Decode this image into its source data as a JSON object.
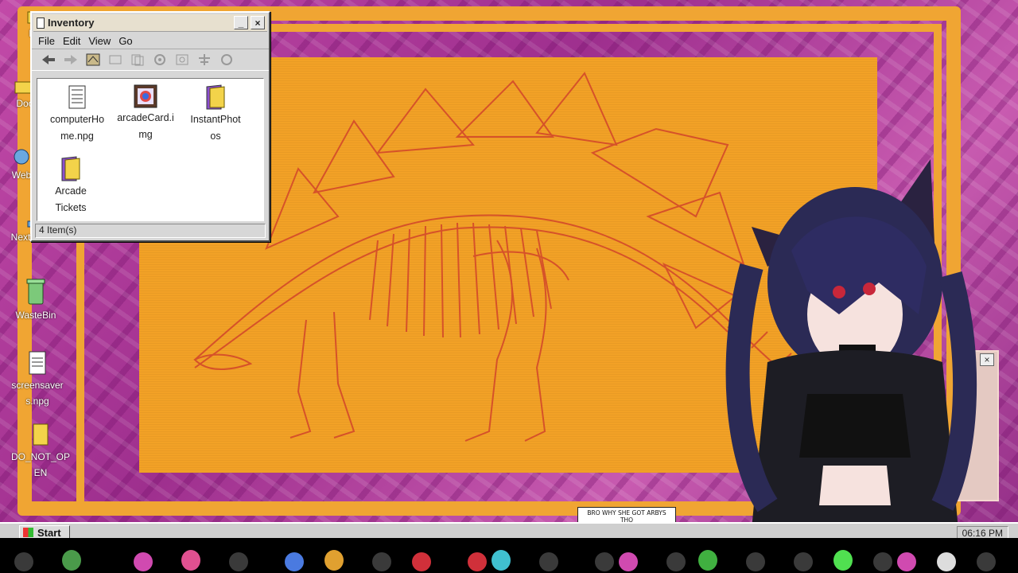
{
  "desktop": {
    "icons": [
      {
        "name": "desktop-icon-docs-1",
        "label": "Doc",
        "type": "folder"
      },
      {
        "name": "desktop-icon-docs-2",
        "label": "Doc",
        "type": "folder"
      },
      {
        "name": "desktop-icon-web",
        "label": "Web",
        "type": "globe"
      },
      {
        "name": "desktop-icon-nexthooms",
        "label": "NextHooms",
        "type": "globe"
      },
      {
        "name": "desktop-icon-wastebin",
        "label": "WasteBin",
        "type": "bin"
      },
      {
        "name": "desktop-icon-screensavers",
        "label": "screensavers.npg",
        "type": "note"
      },
      {
        "name": "desktop-icon-do-not-open",
        "label": "DO_NOT_OPEN",
        "type": "folder"
      }
    ]
  },
  "inventory_window": {
    "title": "Inventory",
    "menu": [
      "File",
      "Edit",
      "View",
      "Go"
    ],
    "files": [
      {
        "label": "computerHome.npg",
        "type": "note"
      },
      {
        "label": "arcadeCard.img",
        "type": "image"
      },
      {
        "label": "InstantPhotos",
        "type": "folder"
      },
      {
        "label": "Arcade Tickets",
        "type": "folder"
      }
    ],
    "status": "4 Item(s)",
    "minimize_label": "_",
    "close_label": "×"
  },
  "secondary_window": {
    "close_label": "×"
  },
  "chat_bubble": {
    "line1": "BRO WHY SHE GOT ARBYS",
    "line2": "THO"
  },
  "taskbar": {
    "start_label": "Start",
    "clock": "06:16 PM"
  },
  "colors": {
    "orange": "#f0a533",
    "magenta": "#b23a9c",
    "window_gray": "#d7d7d7",
    "skeleton_red": "#d2452a"
  }
}
